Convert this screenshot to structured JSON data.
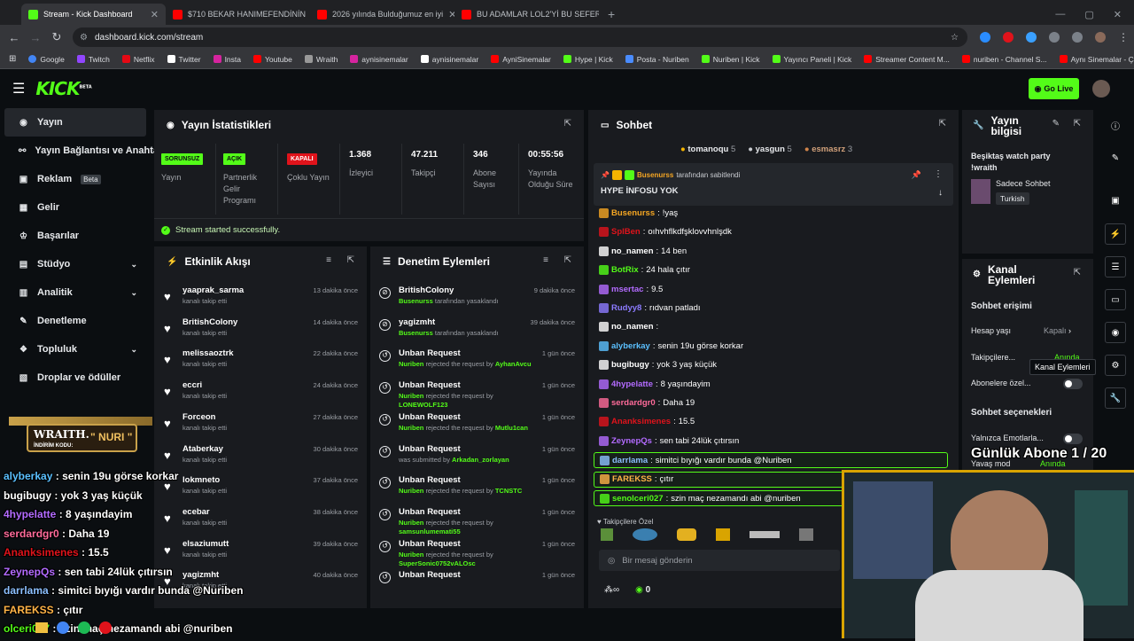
{
  "browser": {
    "tabs": [
      {
        "title": "Stream - Kick Dashboard",
        "icon": "kick-icon",
        "color": "#53fc18",
        "active": true
      },
      {
        "title": "$710 BEKAR HANIMEFENDİNİN",
        "icon": "youtube-icon",
        "color": "#ff0000",
        "active": false
      },
      {
        "title": "2026 yılında Bulduğumuz en iyi",
        "icon": "youtube-icon",
        "color": "#ff0000",
        "active": false
      },
      {
        "title": "BU ADAMLAR LOL2'Yİ BU SEFER",
        "icon": "youtube-icon",
        "color": "#ff0000",
        "active": false
      }
    ],
    "url": "dashboard.kick.com/stream",
    "bookmarks": [
      "Google",
      "Twitch",
      "Netflix",
      "Twitter",
      "Insta",
      "Youtube",
      "Wraith",
      "aynisinemalar",
      "aynisinemalar",
      "AyniSinemalar",
      "Hype | Kick",
      "Posta - Nuriben",
      "Nuriben | Kick",
      "Yayıncı Paneli | Kick",
      "Streamer Content M...",
      "nuriben - Channel S...",
      "Aynı Sinemalar - Ça..."
    ]
  },
  "header": {
    "logo": "KICK",
    "logo_beta": "BETA",
    "go_live": "Go Live"
  },
  "sidebar": {
    "items": [
      {
        "label": "Yayın",
        "icon": "broadcast-icon"
      },
      {
        "label": "Yayın Bağlantısı ve Anahtar",
        "icon": "link-icon"
      },
      {
        "label": "Reklam",
        "icon": "ad-icon",
        "badge": "Beta"
      },
      {
        "label": "Gelir",
        "icon": "grid-icon"
      },
      {
        "label": "Başarılar",
        "icon": "trophy-icon"
      },
      {
        "label": "Stüdyo",
        "icon": "studio-icon"
      },
      {
        "label": "Analitik",
        "icon": "chart-icon"
      },
      {
        "label": "Denetleme",
        "icon": "wrench-icon"
      },
      {
        "label": "Topluluk",
        "icon": "community-icon"
      },
      {
        "label": "Droplar ve ödüller",
        "icon": "gift-icon"
      }
    ]
  },
  "stats": {
    "title": "Yayın İstatistikleri",
    "items": [
      {
        "badge": "SORUNSUZ",
        "badge_color": "#53fc18",
        "label": "Yayın"
      },
      {
        "badge": "AÇIK",
        "badge_color": "#53fc18",
        "label": "Partnerlik Gelir Programı"
      },
      {
        "badge": "KAPALI",
        "badge_color": "#e0131b",
        "label": "Çoklu Yayın"
      },
      {
        "value": "1.368",
        "label": "İzleyici"
      },
      {
        "value": "47.211",
        "label": "Takipçi"
      },
      {
        "value": "346",
        "label": "Abone Sayısı"
      },
      {
        "value": "00:55:56",
        "label": "Yayında Olduğu Süre"
      }
    ],
    "success": "Stream started successfully."
  },
  "activity": {
    "title": "Etkinlik Akışı",
    "rows": [
      {
        "name": "yaaprak_sarma",
        "sub": "kanalı takip etti",
        "time": "13 dakika önce"
      },
      {
        "name": "BritishColony",
        "sub": "kanalı takip etti",
        "time": "14 dakika önce"
      },
      {
        "name": "melissaoztrk",
        "sub": "kanalı takip etti",
        "time": "22 dakika önce"
      },
      {
        "name": "eccri",
        "sub": "kanalı takip etti",
        "time": "24 dakika önce"
      },
      {
        "name": "Forceon",
        "sub": "kanalı takip etti",
        "time": "27 dakika önce"
      },
      {
        "name": "Ataberkay",
        "sub": "kanalı takip etti",
        "time": "30 dakika önce"
      },
      {
        "name": "lokmneto",
        "sub": "kanalı takip etti",
        "time": "37 dakika önce"
      },
      {
        "name": "ecebar",
        "sub": "kanalı takip etti",
        "time": "38 dakika önce"
      },
      {
        "name": "elsaziumutt",
        "sub": "kanalı takip etti",
        "time": "39 dakika önce"
      },
      {
        "name": "yagizmht",
        "sub": "kanalı takip etti",
        "time": "40 dakika önce"
      }
    ]
  },
  "moderation": {
    "title": "Denetim Eylemleri",
    "rows": [
      {
        "name": "BritishColony",
        "actor": "Busenurss",
        "rest": "tarafından yasaklandı",
        "time": "9 dakika önce",
        "icon": "ban-icon"
      },
      {
        "name": "yagizmht",
        "actor": "Busenurss",
        "rest": "tarafından yasaklandı",
        "time": "39 dakika önce",
        "icon": "ban-icon"
      },
      {
        "name": "Unban Request",
        "actor": "Nuriben",
        "rest": "rejected the request by",
        "target": "AyhanAvcu",
        "time": "1 gün önce",
        "icon": "history-icon"
      },
      {
        "name": "Unban Request",
        "actor": "Nuriben",
        "rest": "rejected the request by",
        "target": "LONEWOLF123",
        "time": "1 gün önce",
        "icon": "history-icon"
      },
      {
        "name": "Unban Request",
        "actor": "Nuriben",
        "rest": "rejected the request by",
        "target": "Mutlu1can",
        "time": "1 gün önce",
        "icon": "history-icon"
      },
      {
        "name": "Unban Request",
        "actor": "",
        "rest": "was submitted by",
        "target": "Arkadan_zorlayan",
        "time": "1 gün önce",
        "icon": "history-icon"
      },
      {
        "name": "Unban Request",
        "actor": "Nuriben",
        "rest": "rejected the request by",
        "target": "TCNSTC",
        "time": "1 gün önce",
        "icon": "history-icon"
      },
      {
        "name": "Unban Request",
        "actor": "Nuriben",
        "rest": "rejected the request by",
        "target": "samsunlumemati55",
        "time": "1 gün önce",
        "icon": "history-icon"
      },
      {
        "name": "Unban Request",
        "actor": "Nuriben",
        "rest": "rejected the request by",
        "target": "SuperSonic0752vALOsc",
        "time": "1 gün önce",
        "icon": "history-icon"
      },
      {
        "name": "Unban Request",
        "actor": "",
        "rest": "",
        "target": "",
        "time": "1 gün önce",
        "icon": "history-icon"
      }
    ]
  },
  "chat": {
    "title": "Sohbet",
    "top_gifters": [
      {
        "name": "tomanoqu",
        "count": "5"
      },
      {
        "name": "yasgun",
        "count": "5"
      },
      {
        "name": "esmasrz",
        "count": "3"
      }
    ],
    "pinned_by": "Busenurss",
    "pinned_suffix": "tarafından sabitlendi",
    "pinned_msg": "HYPE İNFOSU YOK",
    "messages": [
      {
        "user": "Busenurss",
        "color": "#f5a623",
        "text": "!yaş"
      },
      {
        "user": "SplBen",
        "color": "#e0131b",
        "text": "oıhvhflkdfşklovvhnlşdk"
      },
      {
        "user": "no_namen",
        "color": "#ffffff",
        "text": "14 ben"
      },
      {
        "user": "BotRix",
        "color": "#53fc18",
        "text": "24 hala çıtır"
      },
      {
        "user": "msertac",
        "color": "#b36bff",
        "text": "9.5"
      },
      {
        "user": "Rudyy8",
        "color": "#8c7bff",
        "text": "rıdvan patladı"
      },
      {
        "user": "no_namen",
        "color": "#ffffff",
        "text": ""
      },
      {
        "user": "alyberkay",
        "color": "#5bc0ff",
        "text": "senin 19u görse korkar"
      },
      {
        "user": "bugibugy",
        "color": "#ffffff",
        "text": "yok 3 yaş küçük"
      },
      {
        "user": "4hypelatte",
        "color": "#b36bff",
        "text": "8 yaşındayim"
      },
      {
        "user": "serdardgr0",
        "color": "#ff6b9a",
        "text": "Daha 19"
      },
      {
        "user": "Ananksimenes",
        "color": "#e0131b",
        "text": "15.5"
      },
      {
        "user": "ZeynepQs",
        "color": "#b36bff",
        "text": "sen tabi 24lük çıtırsın"
      },
      {
        "user": "darrlama",
        "color": "#8cc0ff",
        "text": "simitci bıyığı vardır bunda @Nuriben"
      },
      {
        "user": "FAREKSS",
        "color": "#ffb347",
        "text": "çıtır"
      },
      {
        "user": "senolceri027",
        "color": "#53fc18",
        "text": "szin maç nezamandı abi @nuriben"
      }
    ],
    "followers_label": "Takipçilere Özel",
    "input_placeholder": "Bir mesaj gönderin",
    "viewer_count": "0"
  },
  "stream_info": {
    "title": "Yayın bilgisi",
    "stream_title": "Beşiktaş watch party !wraith",
    "category": "Sadece Sohbet",
    "language": "Turkish"
  },
  "channel_actions": {
    "title": "Kanal Eylemleri",
    "chat_access": "Sohbet erişimi",
    "account_age": "Hesap yaşı",
    "account_age_value": "Kapalı",
    "followers": "Takipçilere...",
    "followers_value": "Anında",
    "subs_only": "Abonelere özel...",
    "chat_options": "Sohbet seçenekleri",
    "emotes_only": "Yalnızca Emotlarla...",
    "slow_mode": "Yavaş mod",
    "slow_mode_value": "Anında",
    "tooltip": "Kanal Eylemleri"
  },
  "overlay": {
    "brand": "WRAITH.",
    "code_label": "İNDİRİM KODU:",
    "code": "\" NURI \"",
    "sub_goal": "Günlük Abone 1 / 20",
    "chat": [
      {
        "user": "alyberkay",
        "color": "#5bc0ff",
        "text": "senin 19u görse korkar"
      },
      {
        "user": "bugibugy",
        "color": "#ffffff",
        "text": "yok 3 yaş küçük"
      },
      {
        "user": "4hypelatte",
        "color": "#b36bff",
        "text": "8 yaşındayim"
      },
      {
        "user": "serdardgr0",
        "color": "#ff6b9a",
        "text": "Daha 19"
      },
      {
        "user": "Ananksimenes",
        "color": "#e0131b",
        "text": "15.5"
      },
      {
        "user": "ZeynepQs",
        "color": "#b36bff",
        "text": "sen tabi 24lük çıtırsın"
      },
      {
        "user": "darrlama",
        "color": "#8cc0ff",
        "text": "simitci bıyığı vardır bunda @Nuriben"
      },
      {
        "user": "FAREKSS",
        "color": "#ffb347",
        "text": "çıtır"
      },
      {
        "user": "olceri027",
        "color": "#53fc18",
        "text": "szin maç nezamandı abi @nuriben"
      }
    ]
  }
}
